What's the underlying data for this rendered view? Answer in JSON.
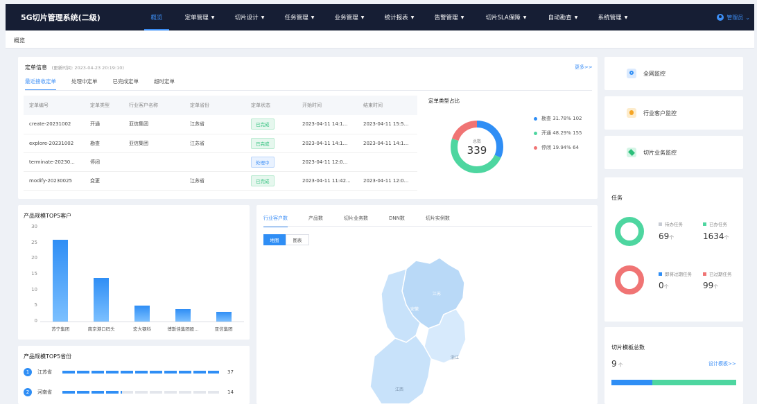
{
  "app": {
    "title": "5G切片管理系统(二级)"
  },
  "nav": [
    {
      "label": "概览",
      "caret": ""
    },
    {
      "label": "定单管理",
      "caret": "▼"
    },
    {
      "label": "切片设计",
      "caret": "▼"
    },
    {
      "label": "任务管理",
      "caret": "▼"
    },
    {
      "label": "业务管理",
      "caret": "▼"
    },
    {
      "label": "统计报表",
      "caret": "▼"
    },
    {
      "label": "告警管理",
      "caret": "▼"
    },
    {
      "label": "切片SLA保障",
      "caret": "▼"
    },
    {
      "label": "自动勘查",
      "caret": "▼"
    },
    {
      "label": "系统管理",
      "caret": "▼"
    }
  ],
  "user": {
    "name": "管理员",
    "caret": "⌄"
  },
  "breadcrumb": "概览",
  "orders": {
    "title": "定单信息",
    "updated": "(更新时间: 2023-04-23 20:19:10)",
    "more": "更多>>",
    "tabs": [
      "最近接收定单",
      "处理中定单",
      "已完成定单",
      "超时定单"
    ],
    "columns": [
      "定单编号",
      "定单类型",
      "行业客户名称",
      "定单省份",
      "定单状态",
      "开始时间",
      "结束时间"
    ],
    "rows": [
      [
        "create-20231002",
        "开通",
        "亚信集团",
        "江苏省",
        "已完成",
        "2023-04-11 14:1...",
        "2023-04-11 15:5..."
      ],
      [
        "explore-20231002",
        "勘查",
        "亚信集团",
        "江苏省",
        "已完成",
        "2023-04-11 14:1...",
        "2023-04-11 14:1..."
      ],
      [
        "terminate-20230...",
        "停闭",
        "",
        "",
        "处理中",
        "2023-04-11 12:0...",
        ""
      ],
      [
        "modify-20230025",
        "变更",
        "",
        "江苏省",
        "已完成",
        "2023-04-11 11:42...",
        "2023-04-11 12:0..."
      ]
    ],
    "status_colors": {
      "已完成": "done",
      "处理中": "proc"
    }
  },
  "order_type": {
    "title": "定单类型占比",
    "total_label": "总数",
    "total": "339",
    "legend": [
      {
        "label": "勘查 31.78% 102",
        "color": "#2f8ef5",
        "value": 102
      },
      {
        "label": "开通 48.29% 155",
        "color": "#4ed6a0",
        "value": 155
      },
      {
        "label": "停闭 19.94% 64",
        "color": "#f07474",
        "value": 64
      }
    ]
  },
  "side": {
    "items": [
      {
        "label": "全网监控",
        "color": "#2f8ef5"
      },
      {
        "label": "行业客户监控",
        "color": "#f5a524"
      },
      {
        "label": "切片业务监控",
        "color": "#2bbf7a"
      }
    ],
    "tasks": {
      "title": "任务",
      "pending_label": "待办任务",
      "pending": "69",
      "done_label": "已办任务",
      "done": "1634",
      "expiring_label": "即将过期任务",
      "expiring": "0",
      "expired_label": "已过期任务",
      "expired": "99",
      "unit": "个",
      "colors": {
        "pending": "#c8ccd4",
        "done": "#4ed6a0",
        "expiring": "#2f8ef5",
        "expired": "#f07474"
      }
    },
    "templates": {
      "title": "切片模板总数",
      "count": "9",
      "unit": "个",
      "link": "设计模板>>",
      "split": [
        0.33,
        0.67
      ]
    }
  },
  "chart_data": {
    "type": "bar",
    "title": "产品规模TOP5客户",
    "categories": [
      "苏宁集团",
      "南京港口码头",
      "宏大钢科",
      "博斯佳集团股...",
      "亚信集团"
    ],
    "values": [
      26,
      14,
      5,
      4,
      3
    ],
    "ylim": [
      0,
      30
    ],
    "yticks": [
      0,
      5,
      10,
      15,
      20,
      25,
      30
    ]
  },
  "province_top": {
    "title": "产品规模TOP5省份",
    "items": [
      {
        "rank": "1",
        "name": "江苏省",
        "value": "37",
        "filled": 1.0
      },
      {
        "rank": "2",
        "name": "河南省",
        "value": "14",
        "filled": 0.38
      }
    ]
  },
  "map_panel": {
    "tabs": [
      "行业客户数",
      "产品数",
      "切片业务数",
      "DNN数",
      "切片实例数"
    ],
    "toggle": [
      "地图",
      "图表"
    ],
    "regions": [
      "江苏",
      "安徽",
      "浙江",
      "江西"
    ]
  }
}
